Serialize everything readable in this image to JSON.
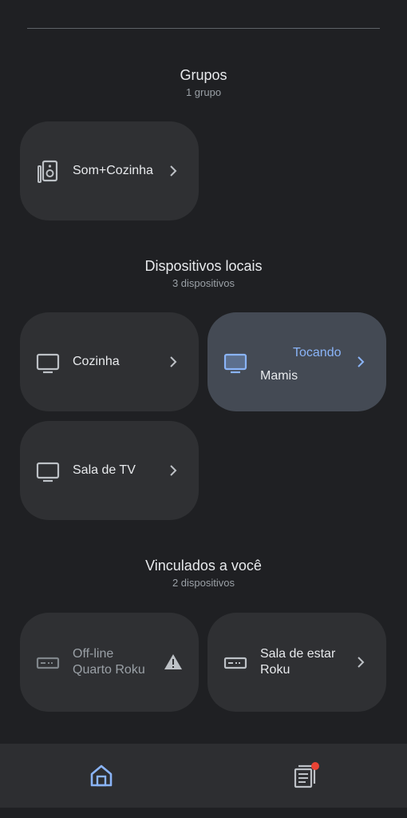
{
  "groups": {
    "title": "Grupos",
    "subtitle": "1 grupo",
    "items": [
      {
        "label": "Som+Cozinha",
        "icon": "speaker-group-icon"
      }
    ]
  },
  "local": {
    "title": "Dispositivos locais",
    "subtitle": "3 dispositivos",
    "items": [
      {
        "label": "Cozinha",
        "icon": "tv-icon"
      },
      {
        "label": "Mamis",
        "status": "Tocando",
        "icon": "tv-icon",
        "active": true
      },
      {
        "label": "Sala de TV",
        "icon": "tv-icon"
      }
    ]
  },
  "linked": {
    "title": "Vinculados a você",
    "subtitle": "2 dispositivos",
    "items": [
      {
        "status": "Off-line",
        "label": "Quarto Roku",
        "icon": "streaming-box-icon",
        "alert_icon": "warning-icon"
      },
      {
        "label": "Sala de estar Roku",
        "icon": "streaming-box-icon"
      }
    ]
  },
  "nav": {
    "items": [
      {
        "icon": "home-icon",
        "active": true
      },
      {
        "icon": "library-icon",
        "badge": true
      }
    ]
  },
  "colors": {
    "accent": "#8ab4f8",
    "badge": "#ea4335",
    "tile": "#2f3033",
    "active_tile": "#444a54"
  }
}
